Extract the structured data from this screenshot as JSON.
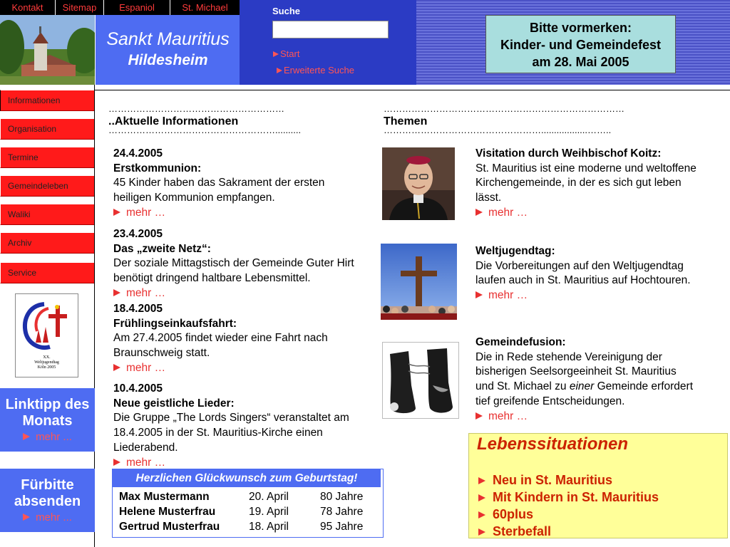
{
  "topbar": {
    "links": [
      "Kontakt",
      "Sitemap",
      "Espaniol",
      "St. Michael"
    ]
  },
  "header": {
    "title": "Sankt Mauritius",
    "subtitle": "Hildesheim"
  },
  "search": {
    "label": "Suche",
    "value": "",
    "start": "Start",
    "advanced": "Erweiterte Suche"
  },
  "notice": {
    "line1": "Bitte vormerken:",
    "line2": "Kinder- und Gemeindefest",
    "line3": "am 28. Mai 2005"
  },
  "nav": {
    "items": [
      "Informationen",
      "Organisation",
      "Termine",
      "Gemeindeleben",
      "Waliki",
      "Archiv",
      "Service"
    ]
  },
  "logo": {
    "line1": "XX.",
    "line2": "Weltjugendtag",
    "line3": "Köln 2005"
  },
  "linktipp": {
    "title": "Linktipp des Monats",
    "more": "mehr ..."
  },
  "fuerbitte": {
    "title": "Fürbitte absenden",
    "more": "mehr ..."
  },
  "sections": {
    "news_title": "Aktuelle Informationen",
    "news_dots_top": "…………………………………………………",
    "news_dots_bottom": "..",
    "news_dots_under": "………………………………………………..........",
    "themes_title": "Themen",
    "themes_dots_top": "……………………………………………………………………",
    "themes_dots_under": "……………………………………………..................…….."
  },
  "news": [
    {
      "date": "24.4.2005",
      "headline": "Erstkommunion:",
      "text": "45 Kinder haben das Sakrament der ersten heiligen Kommunion empfangen.",
      "more": "mehr …"
    },
    {
      "date": "23.4.2005",
      "headline": "Das „zweite Netz“:",
      "text": "Der soziale Mittagstisch der Gemeinde Guter Hirt benötigt dringend haltbare Lebensmittel.",
      "more": "mehr …"
    },
    {
      "date": "18.4.2005",
      "headline": "Frühlingseinkaufsfahrt:",
      "text": "Am 27.4.2005 findet wieder eine Fahrt nach Braunschweig statt.",
      "more": "mehr …"
    },
    {
      "date": "10.4.2005",
      "headline": "Neue geistliche Lieder:",
      "text": "Die Gruppe „The Lords Singers“ veranstaltet am 18.4.2005 in der St. Mauritius-Kirche einen Liederabend.",
      "more": "mehr …"
    }
  ],
  "themes": [
    {
      "headline": "Visitation durch Weihbischof Koitz:",
      "text": "St. Mauritius ist eine moderne und weltoffene Kirchengemeinde, in der es sich gut leben lässt.",
      "more": "mehr …"
    },
    {
      "headline": "Weltjugendtag:",
      "text": "Die Vorbereitungen auf den Weltjugendtag laufen auch in St. Mauritius auf Hochtouren.",
      "more": "mehr …"
    },
    {
      "headline": "Gemeindefusion:",
      "text_a": "Die in Rede stehende Vereinigung der bisherigen Seelsorgeeinheit St. Mauritius und St. Michael zu ",
      "text_em": "einer",
      "text_b": " Gemeinde erfordert tief greifende Entscheidungen.",
      "more": "mehr …"
    }
  ],
  "birthday": {
    "title": "Herzlichen Glückwunsch zum Geburtstag!",
    "rows": [
      {
        "name": "Max Mustermann",
        "date": "20. April",
        "age": "80 Jahre"
      },
      {
        "name": "Helene Musterfrau",
        "date": "19. April",
        "age": "78 Jahre"
      },
      {
        "name": "Gertrud Musterfrau",
        "date": "18. April",
        "age": "95 Jahre"
      }
    ]
  },
  "lebenssituationen": {
    "title": "Lebenssituationen",
    "items": [
      "Neu in St. Mauritius",
      "Mit Kindern in St. Mauritius",
      "60plus",
      "Sterbefall"
    ]
  },
  "colors": {
    "nav_red": "#ff1a1a",
    "header_blue": "#4e6cf2",
    "search_blue": "#2b3bc4",
    "link_red": "#e83030",
    "notice_bg": "#a9dede",
    "leben_bg": "#ffff99"
  }
}
